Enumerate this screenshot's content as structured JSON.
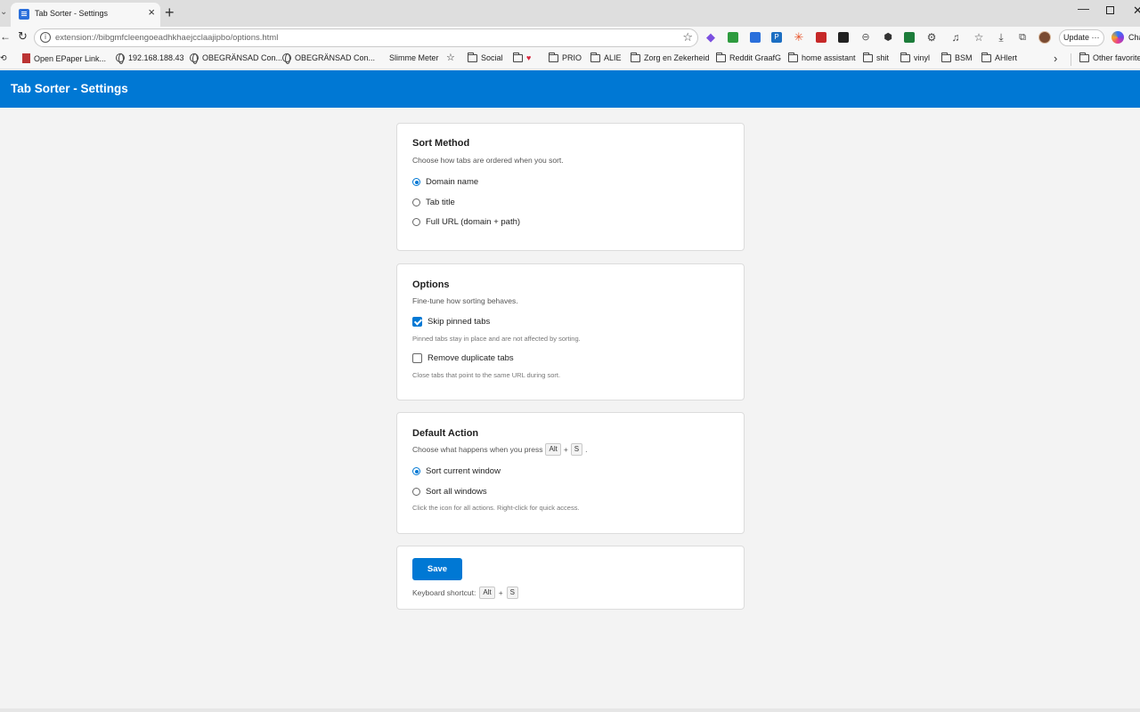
{
  "browser": {
    "tab_title": "Tab Sorter - Settings",
    "url": "extension://bibgmfcleengoeadhkhaejcclaajipbo/options.html",
    "update_label": "Update",
    "copilot_label": "Cha",
    "bookmarks": [
      {
        "label": "Open EPaper Link...",
        "icon": "page-icon"
      },
      {
        "label": "192.168.188.43",
        "icon": "globe-icon"
      },
      {
        "label": "OBEGRÄNSAD Con...",
        "icon": "globe-icon"
      },
      {
        "label": "OBEGRÄNSAD Con...",
        "icon": "globe-icon"
      },
      {
        "label": "Slimme Meter",
        "icon": "none"
      },
      {
        "label": "",
        "icon": "star-list-icon"
      },
      {
        "label": "Social",
        "icon": "folder-icon"
      },
      {
        "label": "♥",
        "icon": "folder-icon"
      },
      {
        "label": "PRIO",
        "icon": "folder-icon"
      },
      {
        "label": "ALIE",
        "icon": "folder-icon"
      },
      {
        "label": "Zorg en Zekerheid",
        "icon": "folder-icon"
      },
      {
        "label": "Reddit GraafG",
        "icon": "folder-icon"
      },
      {
        "label": "home assistant",
        "icon": "folder-icon"
      },
      {
        "label": "shit",
        "icon": "folder-icon"
      },
      {
        "label": "vinyl",
        "icon": "folder-icon"
      },
      {
        "label": "BSM",
        "icon": "folder-icon"
      },
      {
        "label": "AHlert",
        "icon": "folder-icon"
      }
    ],
    "other_favorites": "Other favorites"
  },
  "app": {
    "title": "Tab Sorter - Settings",
    "accent": "#0078d4"
  },
  "sort_method": {
    "heading": "Sort Method",
    "description": "Choose how tabs are ordered when you sort.",
    "options": [
      {
        "label": "Domain name",
        "selected": true
      },
      {
        "label": "Tab title",
        "selected": false
      },
      {
        "label": "Full URL (domain + path)",
        "selected": false
      }
    ]
  },
  "options": {
    "heading": "Options",
    "description": "Fine-tune how sorting behaves.",
    "skip_pinned": {
      "label": "Skip pinned tabs",
      "checked": true,
      "hint": "Pinned tabs stay in place and are not affected by sorting."
    },
    "remove_duplicates": {
      "label": "Remove duplicate tabs",
      "checked": false,
      "hint": "Close tabs that point to the same URL during sort."
    }
  },
  "default_action": {
    "heading": "Default Action",
    "description_prefix": "Choose what happens when you press",
    "key1": "Alt",
    "plus": "+",
    "key2": "S",
    "description_suffix": ".",
    "options": [
      {
        "label": "Sort current window",
        "selected": true
      },
      {
        "label": "Sort all windows",
        "selected": false
      }
    ],
    "hint": "Click the icon for all actions. Right-click for quick access."
  },
  "save": {
    "button_label": "Save",
    "shortcut_prefix": "Keyboard shortcut:",
    "key1": "Alt",
    "plus": "+",
    "key2": "S"
  }
}
